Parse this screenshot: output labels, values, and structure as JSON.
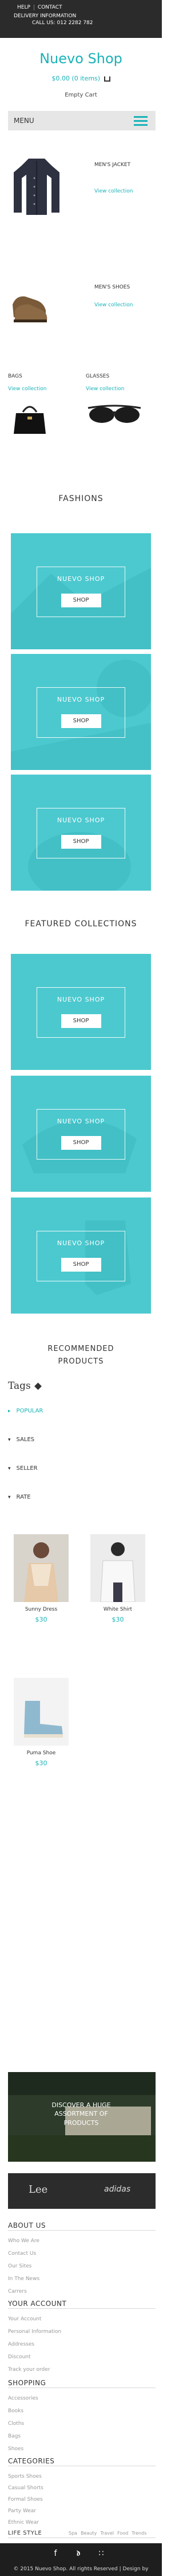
{
  "topbar": {
    "links": [
      "HELP",
      "CONTACT"
    ],
    "delivery": "DELIVERY INFORMATION",
    "call": "CALL US: 012 2282 782"
  },
  "header": {
    "logo": "Nuevo Shop",
    "cart": "$0.00 (0 items)",
    "cart_status": "Empty Cart",
    "menu_label": "MENU"
  },
  "categories": [
    {
      "title": "MEN'S JACKET",
      "link": "View collection"
    },
    {
      "title": "MEN'S SHOES",
      "link": "View collection"
    },
    {
      "title": "BAGS",
      "link": "View collection"
    },
    {
      "title": "GLASSES",
      "link": "View collection"
    }
  ],
  "fashions": {
    "title": "FASHIONS",
    "banners": [
      {
        "title": "NUEVO SHOP",
        "button": "SHOP"
      },
      {
        "title": "NUEVO SHOP",
        "button": "SHOP"
      },
      {
        "title": "NUEVO SHOP",
        "button": "SHOP"
      }
    ]
  },
  "featured": {
    "title": "FEATURED COLLECTIONS",
    "banners": [
      {
        "title": "NUEVO SHOP",
        "button": "SHOP"
      },
      {
        "title": "NUEVO SHOP",
        "button": "SHOP"
      },
      {
        "title": "NUEVO SHOP",
        "button": "SHOP"
      }
    ]
  },
  "recommended": {
    "title_line1": "RECOMMENDED",
    "title_line2": "PRODUCTS"
  },
  "tags": {
    "title": "Tags",
    "items": [
      {
        "label": "POPULAR",
        "active": true
      },
      {
        "label": "SALES",
        "active": false
      },
      {
        "label": "SELLER",
        "active": false
      },
      {
        "label": "RATE",
        "active": false
      }
    ]
  },
  "products": [
    {
      "name": "Sunny Dress",
      "price": "$30"
    },
    {
      "name": "White Shirt",
      "price": "$30"
    },
    {
      "name": "Puma Shoe",
      "price": "$30"
    }
  ],
  "promo": {
    "text_line1": "DISCOVER A HUGE",
    "text_line2": "ASSORTMENT OF",
    "text_line3": "PRODUCTS"
  },
  "brands": [
    "Lee",
    "adidas"
  ],
  "footer_sections": [
    {
      "title": "ABOUT US",
      "links": [
        "Who We Are",
        "Contact Us",
        "Our Sites",
        "In The News",
        "Carrers"
      ]
    },
    {
      "title": "YOUR ACCOUNT",
      "links": [
        "Your Account",
        "Personal Information",
        "Addresses",
        "Discount",
        "Track your order"
      ]
    },
    {
      "title": "SHOPPING",
      "links": [
        "Accessories",
        "Books",
        "Cloths",
        "Bags",
        "Shoes"
      ]
    },
    {
      "title": "CATEGORIES",
      "links": [
        "Sports Shoes",
        "Casual Shorts",
        "Formal Shoes",
        "Party Wear",
        "Ethnic Wear"
      ]
    },
    {
      "title": "LIFE STYLE",
      "links": [
        "Spa",
        "Beauty",
        "Travel",
        "Food",
        "Trends"
      ]
    }
  ],
  "footer": {
    "copyright": "© 2015 Nuevo Shop. All rights Reserved | Design by"
  },
  "colors": {
    "accent": "#1ab3b8",
    "banner": "#4cc9cf",
    "dark": "#2b2b2b"
  }
}
